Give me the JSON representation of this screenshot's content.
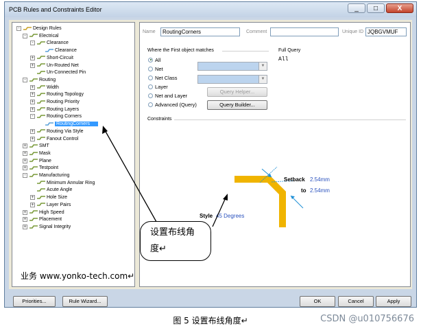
{
  "window": {
    "title": "PCB Rules and Constraints Editor",
    "minimize": "_",
    "maximize": "□",
    "close": "X"
  },
  "tree": [
    {
      "label": "Design Rules",
      "level": 0,
      "expand": "-"
    },
    {
      "label": "Electrical",
      "level": 1,
      "expand": "-"
    },
    {
      "label": "Clearance",
      "level": 2,
      "expand": "-"
    },
    {
      "label": "Clearance",
      "level": 3,
      "expand": ""
    },
    {
      "label": "Short-Circuit",
      "level": 2,
      "expand": "+"
    },
    {
      "label": "Un-Routed Net",
      "level": 2,
      "expand": "+"
    },
    {
      "label": "Un-Connected Pin",
      "level": 2,
      "expand": ""
    },
    {
      "label": "Routing",
      "level": 1,
      "expand": "-"
    },
    {
      "label": "Width",
      "level": 2,
      "expand": "+"
    },
    {
      "label": "Routing Topology",
      "level": 2,
      "expand": "+"
    },
    {
      "label": "Routing Priority",
      "level": 2,
      "expand": "+"
    },
    {
      "label": "Routing Layers",
      "level": 2,
      "expand": "+"
    },
    {
      "label": "Routing Corners",
      "level": 2,
      "expand": "-"
    },
    {
      "label": "RoutingCorners",
      "level": 3,
      "expand": "",
      "selected": true
    },
    {
      "label": "Routing Via Style",
      "level": 2,
      "expand": "+"
    },
    {
      "label": "Fanout Control",
      "level": 2,
      "expand": "+"
    },
    {
      "label": "SMT",
      "level": 1,
      "expand": "+"
    },
    {
      "label": "Mask",
      "level": 1,
      "expand": "+"
    },
    {
      "label": "Plane",
      "level": 1,
      "expand": "+"
    },
    {
      "label": "Testpoint",
      "level": 1,
      "expand": "+"
    },
    {
      "label": "Manufacturing",
      "level": 1,
      "expand": "-"
    },
    {
      "label": "Minimum Annular Ring",
      "level": 2,
      "expand": ""
    },
    {
      "label": "Acute Angle",
      "level": 2,
      "expand": ""
    },
    {
      "label": "Hole Size",
      "level": 2,
      "expand": "+"
    },
    {
      "label": "Layer Pairs",
      "level": 2,
      "expand": "+"
    },
    {
      "label": "High Speed",
      "level": 1,
      "expand": "+"
    },
    {
      "label": "Placement",
      "level": 1,
      "expand": "+"
    },
    {
      "label": "Signal Integrity",
      "level": 1,
      "expand": "+"
    }
  ],
  "rule": {
    "name_label": "Name",
    "name_value": "RoutingCorners",
    "comment_label": "Comment",
    "comment_value": "",
    "uid_label": "Unique ID",
    "uid_value": "JQBGVMUF"
  },
  "scope": {
    "title": "Where the First object matches",
    "options": [
      "All",
      "Net",
      "Net Class",
      "Layer",
      "Net and Layer",
      "Advanced (Query)"
    ],
    "selected": "All",
    "query_helper": "Query Helper...",
    "query_builder": "Query Builder..."
  },
  "full_query": {
    "title": "Full Query",
    "value": "All"
  },
  "constraints": {
    "title": "Constraints",
    "setback_label": "Setback",
    "setback_value": "2.54mm",
    "to_label": "to",
    "to_value": "2.54mm",
    "style_label": "Style",
    "style_value": "45 Degrees"
  },
  "buttons": {
    "priorities": "Priorities...",
    "rule_wizard": "Rule Wizard...",
    "ok": "OK",
    "cancel": "Cancel",
    "apply": "Apply"
  },
  "annotation": {
    "bubble_line1": "设置布线角",
    "bubble_line2": "度↵",
    "footer": "业务 www.yonko-tech.com↵"
  },
  "caption": "图 5 设置布线角度↵",
  "watermark": "CSDN @u010756676",
  "colors": {
    "track": "#f0b400",
    "selection": "#3399ff",
    "arrow": "#1e8fd6"
  }
}
